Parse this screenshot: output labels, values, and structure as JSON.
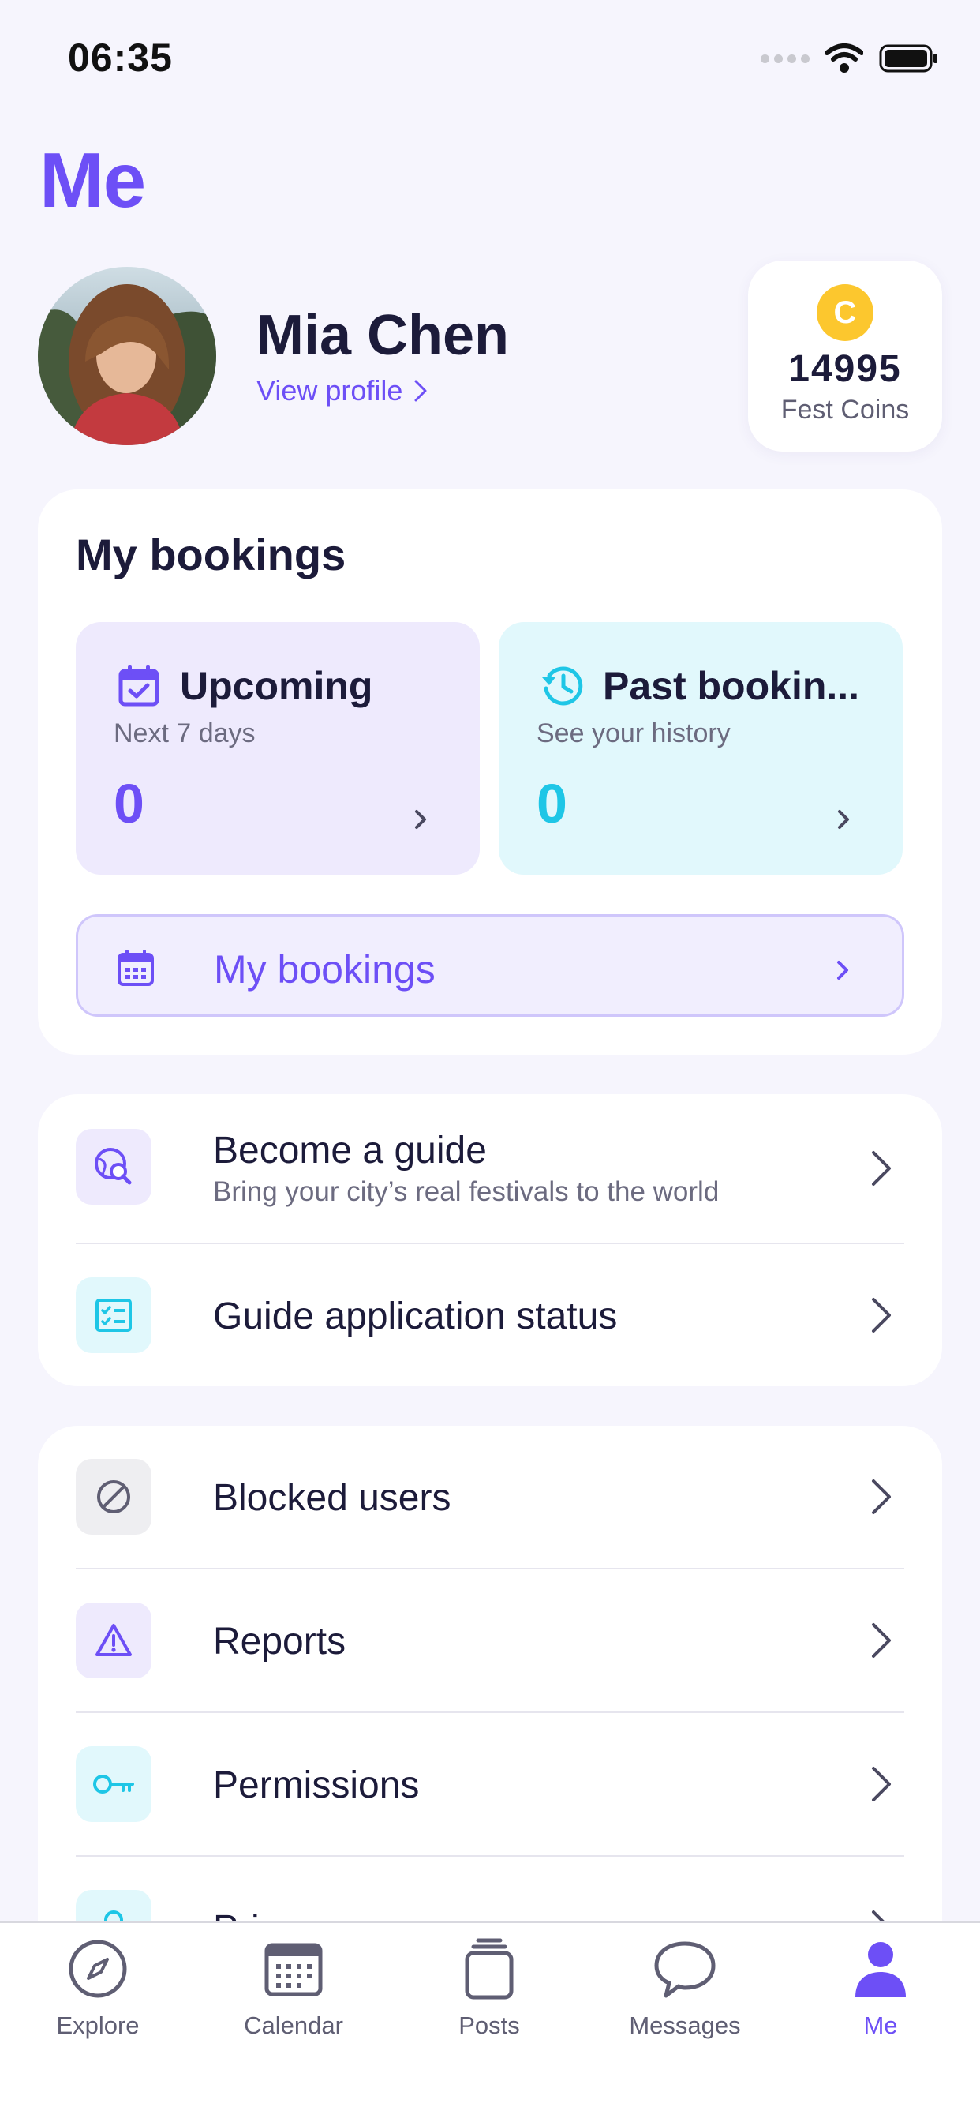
{
  "status_bar": {
    "time": "06:35"
  },
  "page": {
    "title": "Me"
  },
  "profile": {
    "name": "Mia Chen",
    "view_profile": "View profile"
  },
  "coins": {
    "symbol": "C",
    "value": "14995",
    "label": "Fest Coins"
  },
  "bookings": {
    "title": "My bookings",
    "upcoming": {
      "title": "Upcoming",
      "subtitle": "Next 7 days",
      "count": "0"
    },
    "past": {
      "title": "Past bookin...",
      "subtitle": "See your history",
      "count": "0"
    },
    "bar_label": "My bookings"
  },
  "guide": {
    "items": [
      {
        "title": "Become a guide",
        "subtitle": "Bring your city’s real festivals to the world",
        "icon": "globe-search-icon"
      },
      {
        "title": "Guide application status",
        "icon": "checklist-icon"
      }
    ]
  },
  "utilities": {
    "items": [
      {
        "title": "Blocked users",
        "icon": "block-icon"
      },
      {
        "title": "Reports",
        "icon": "warning-icon"
      },
      {
        "title": "Permissions",
        "icon": "key-icon"
      },
      {
        "title": "Privacy",
        "icon": "lock-icon"
      }
    ]
  },
  "tab_bar": {
    "items": [
      {
        "label": "Explore",
        "icon": "compass-icon"
      },
      {
        "label": "Calendar",
        "icon": "calendar-icon"
      },
      {
        "label": "Posts",
        "icon": "posts-icon"
      },
      {
        "label": "Messages",
        "icon": "chat-icon"
      },
      {
        "label": "Me",
        "icon": "person-icon",
        "active": true
      }
    ]
  },
  "colors": {
    "accent": "#6d4ff6",
    "cyan": "#1ec6e6",
    "coin": "#fcc72e",
    "background": "#f6f5fd"
  }
}
